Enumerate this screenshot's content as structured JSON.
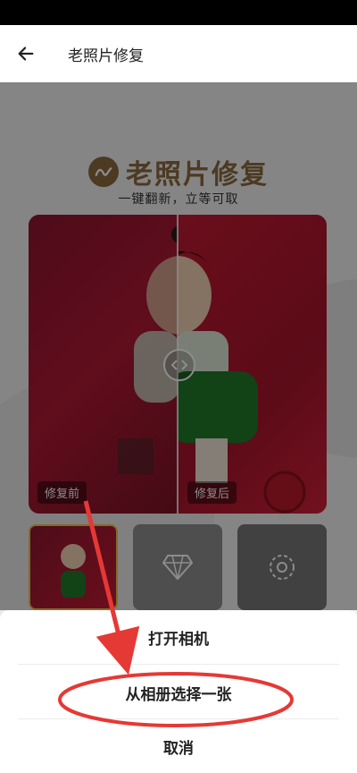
{
  "header": {
    "title": "老照片修复"
  },
  "hero": {
    "brand_title": "老照片修复",
    "slogan": "一键翻新，立等可取",
    "before_label": "修复前",
    "after_label": "修复后"
  },
  "thumbnails": [
    {
      "icon": "photo-icon"
    },
    {
      "icon": "diamond-icon"
    },
    {
      "icon": "camera-icon"
    }
  ],
  "action_sheet": {
    "open_camera": "打开相机",
    "choose_album": "从相册选择一张",
    "cancel": "取消"
  },
  "annotation": {
    "color": "#e53935"
  }
}
